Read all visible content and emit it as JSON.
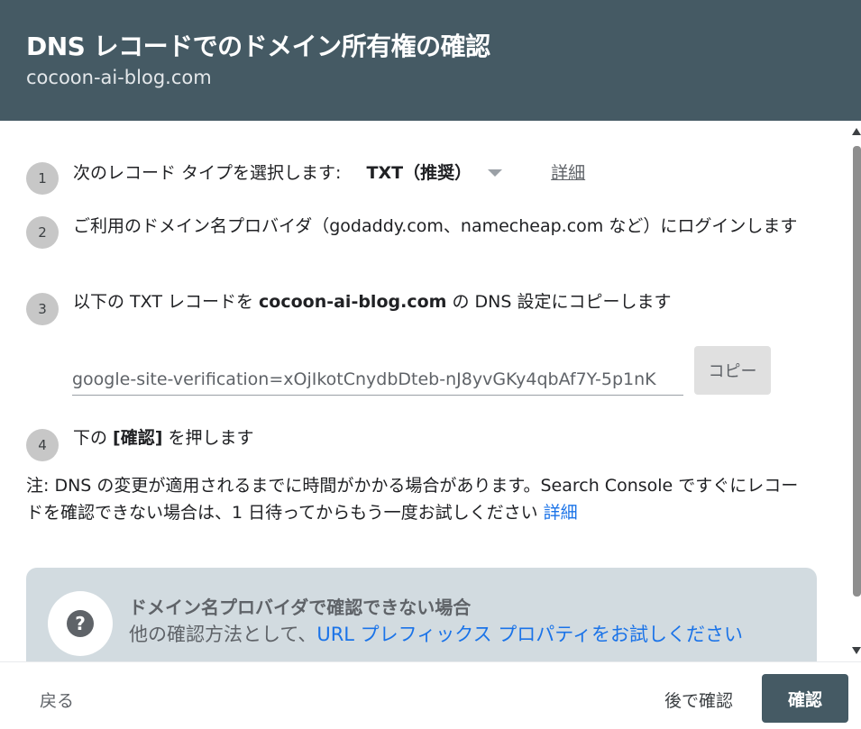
{
  "header": {
    "title": "DNS レコードでのドメイン所有権の確認",
    "subtitle": "cocoon-ai-blog.com"
  },
  "steps": [
    {
      "num": "1",
      "text": "次のレコード タイプを選択します:",
      "dropdown": "TXT（推奨）",
      "link": "詳細"
    },
    {
      "num": "2",
      "text": "ご利用のドメイン名プロバイダ（godaddy.com、namecheap.com など）にログインします"
    },
    {
      "num": "3",
      "prefix": "以下の TXT レコードを ",
      "domain": "cocoon-ai-blog.com",
      "suffix": " の DNS 設定にコピーします"
    },
    {
      "num": "4",
      "prefix": "下の ",
      "bold": "[確認]",
      "suffix": " を押します"
    }
  ],
  "record": {
    "value": "google-site-verification=xOjIkotCnydbDteb-nJ8yvGKy4qbAf7Y-5p1nK",
    "copy_label": "コピー"
  },
  "note": {
    "text": "注: DNS の変更が適用されるまでに時間がかかる場合があります。Search Console ですぐにレコードを確認できない場合は、1 日待ってからもう一度お試しください ",
    "link": "詳細"
  },
  "help": {
    "icon": "help-circle-icon",
    "title": "ドメイン名プロバイダで確認できない場合",
    "text_prefix": "他の確認方法として、",
    "link": "URL プレフィックス プロパティをお試しください"
  },
  "footer": {
    "back_label": "戻る",
    "later_label": "後で確認",
    "verify_label": "確認"
  },
  "colors": {
    "header_bg": "#455a64",
    "link": "#1a73e8",
    "help_bg": "#d2dbe0",
    "primary_button": "#455a64"
  }
}
